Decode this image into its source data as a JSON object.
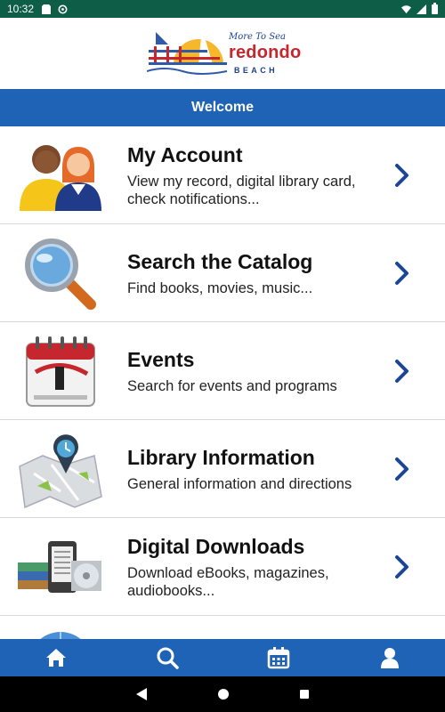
{
  "status_bar": {
    "time": "10:32",
    "left_icons": [
      "sim-icon",
      "sync-icon"
    ],
    "right_icons": [
      "wifi-icon",
      "signal-icon",
      "battery-icon"
    ]
  },
  "logo": {
    "tagline": "More To Sea",
    "name": "redondo",
    "sub": "BEACH"
  },
  "header": {
    "title": "Welcome"
  },
  "menu": {
    "items": [
      {
        "title": "My Account",
        "description": "View my record, digital library card, check notifications...",
        "icon": "people-icon"
      },
      {
        "title": "Search the Catalog",
        "description": "Find books, movies, music...",
        "icon": "magnifier-icon"
      },
      {
        "title": "Events",
        "description": "Search for events and programs",
        "icon": "calendar-icon"
      },
      {
        "title": "Library Information",
        "description": "General information and directions",
        "icon": "map-pin-icon"
      },
      {
        "title": "Digital Downloads",
        "description": "Download eBooks, magazines, audiobooks...",
        "icon": "devices-icon"
      }
    ]
  },
  "bottom_nav": {
    "items": [
      "home-icon",
      "search-icon",
      "calendar-icon",
      "user-icon"
    ]
  },
  "colors": {
    "status_bar": "#0d5d47",
    "brand_blue": "#1f63b7",
    "chevron": "#1c4596",
    "logo_red": "#c6262e"
  }
}
